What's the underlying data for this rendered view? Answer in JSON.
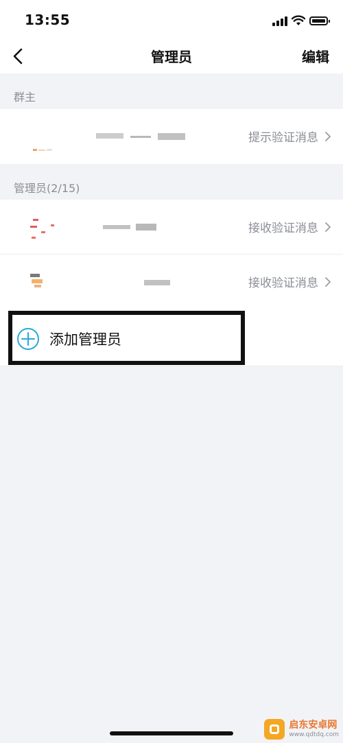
{
  "status_bar": {
    "time": "13:55"
  },
  "nav": {
    "title": "管理员",
    "edit_label": "编辑"
  },
  "owner_section": {
    "header": "群主",
    "row": {
      "action_label": "提示验证消息"
    }
  },
  "admin_section": {
    "header": "管理员(2/15)",
    "rows": [
      {
        "action_label": "接收验证消息"
      },
      {
        "action_label": "接收验证消息"
      }
    ]
  },
  "add_admin": {
    "label": "添加管理员",
    "accent_color": "#29a9d8"
  },
  "watermark": {
    "name": "启东安卓网",
    "url": "www.qdtdq.com"
  },
  "colors": {
    "background": "#f2f3f7",
    "secondary_text": "#8a8d94",
    "accent": "#29a9d8"
  }
}
